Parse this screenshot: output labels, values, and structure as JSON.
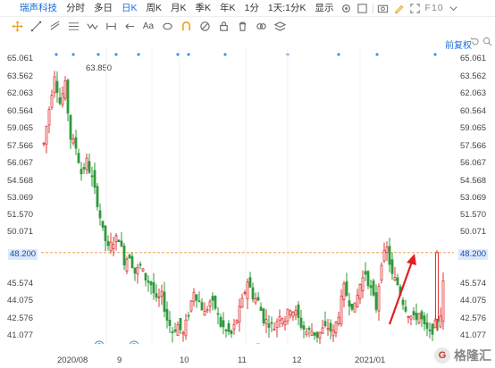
{
  "topbar": {
    "stock_name": "瑞声科技",
    "periods": [
      "分时",
      "多日",
      "日K",
      "周K",
      "月K",
      "季K",
      "年K",
      "1分",
      "1天:1分K"
    ],
    "active_period": "日K",
    "display_label": "显示",
    "fio_label": "F10"
  },
  "toolbar": {
    "text_tool_label": "Aa",
    "adjust_label": "前复权"
  },
  "high_label": "63.850",
  "current_price_tag": "48.200",
  "left_axis": [
    "65.061",
    "63.562",
    "62.063",
    "60.564",
    "59.065",
    "57.566",
    "56.067",
    "54.568",
    "53.069",
    "51.570",
    "50.071",
    "48.200",
    "45.574",
    "44.075",
    "42.576",
    "41.077"
  ],
  "right_axis": [
    "65.061",
    "63.562",
    "62.063",
    "60.564",
    "59.065",
    "57.566",
    "56.067",
    "54.568",
    "53.069",
    "51.570",
    "50.071",
    "48.200",
    "45.574",
    "44.075",
    "42.576",
    "41.077"
  ],
  "x_labels": [
    "2020/08",
    "9",
    "10",
    "11",
    "12",
    "2021/01"
  ],
  "watermark": "格隆汇",
  "colors": {
    "up": "#e03434",
    "down": "#2e9a3a",
    "accent": "#1a6fd6",
    "dashed": "#f0a050",
    "arrow": "#e02020"
  }
}
